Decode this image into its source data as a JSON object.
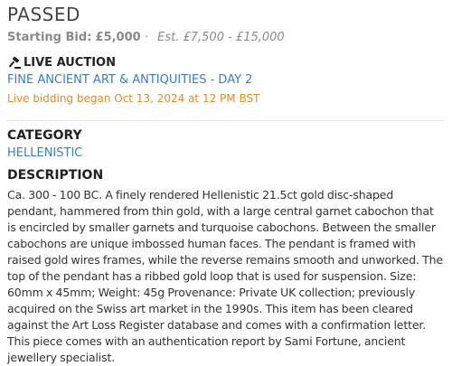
{
  "lot": {
    "status": "PASSED",
    "starting_bid_label": "Starting Bid:",
    "starting_bid_value": "£5,000",
    "separator": "·",
    "estimate": "Est. £7,500 - £15,000"
  },
  "auction": {
    "type_label": "LIVE AUCTION",
    "sale_title": "FINE ANCIENT ART & ANTIQUITIES - DAY 2",
    "bidding_started": "Live bidding began Oct 13, 2024 at 12 PM BST"
  },
  "category": {
    "heading": "CATEGORY",
    "value": "HELLENISTIC"
  },
  "description": {
    "heading": "DESCRIPTION",
    "text": "Ca. 300 - 100 BC. A finely rendered Hellenistic 21.5ct gold disc-shaped pendant, hammered from thin gold, with a large central garnet cabochon that is encircled by smaller garnets and turquoise cabochons. Between the smaller cabochons are unique imbossed human faces. The pendant is framed with raised gold wires frames, while the reverse remains smooth and unworked. The top of the pendant has a ribbed gold loop that is used for suspension. Size: 60mm x 45mm; Weight: 45g Provenance: Private UK collection; previously acquired on the Swiss art market in the 1990s. This item has been cleared against the Art Loss Register database and comes with a confirmation letter. This piece comes with an authentication report by Sami Fortune, ancient jewellery specialist."
  },
  "icons": {
    "auction_type": "gavel-icon"
  },
  "colors": {
    "link": "#3c7cc4",
    "bidding_started": "#e08b2e",
    "muted": "#8a8a8a"
  }
}
